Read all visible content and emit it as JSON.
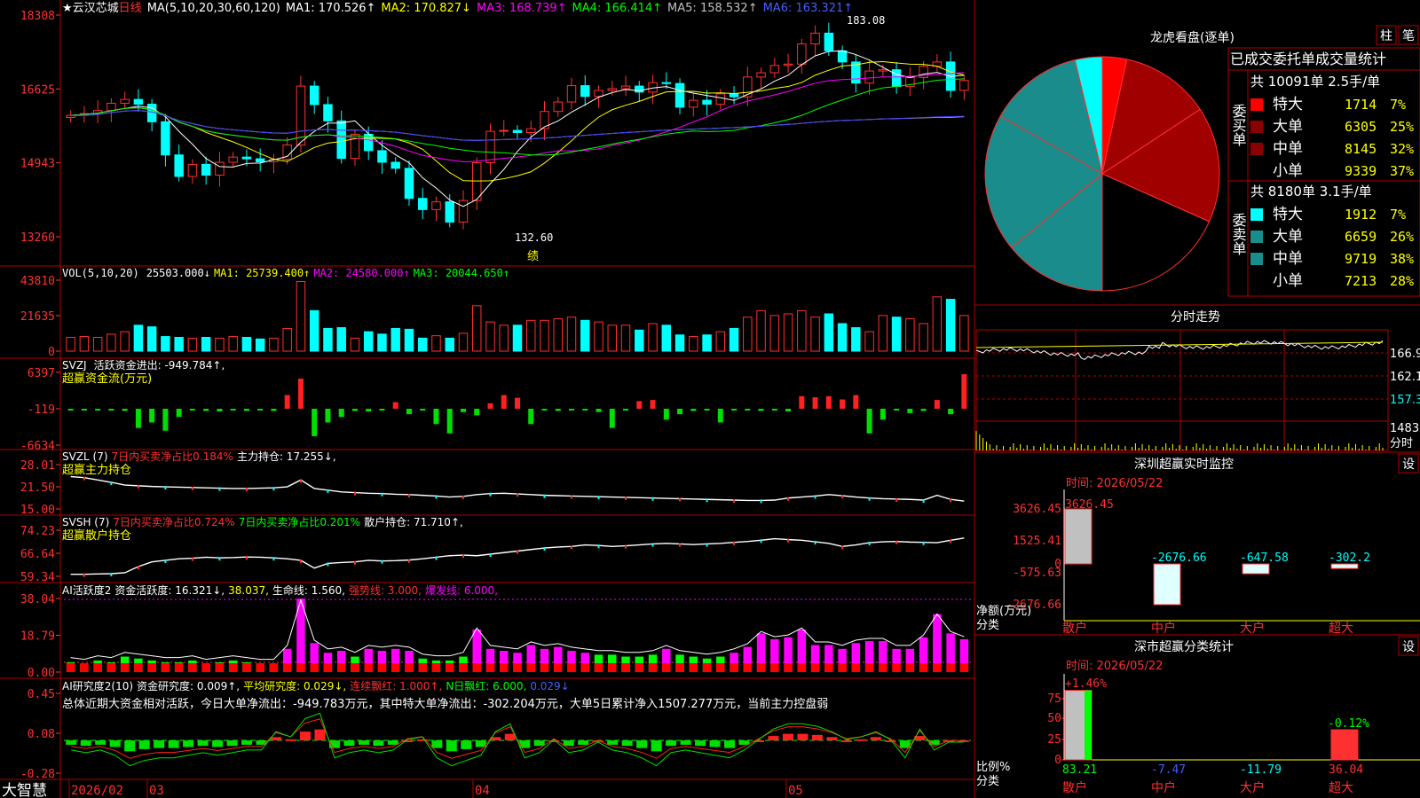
{
  "app": {
    "brand": "大智慧",
    "period_label": "日线",
    "star": "★"
  },
  "stock": {
    "name": "云汉芯城"
  },
  "colors": {
    "up": "#ff3030",
    "down": "#00ffff",
    "ma1": "#ffffff",
    "ma2": "#ffff00",
    "ma3": "#ff00ff",
    "ma4": "#00ff00",
    "ma5": "#c0c0c0",
    "ma6": "#4040ff",
    "frame": "#b00000",
    "grid": "#800000",
    "dark_red": "#8b0000",
    "teal": "#1a8c8c"
  },
  "main": {
    "ma_header": "MA(5,10,20,30,60,120)",
    "ma1": "MA1: 170.526↑",
    "ma2": "MA2: 170.827↓",
    "ma3": "MA3: 168.739↑",
    "ma4": "MA4: 166.414↑",
    "ma5": "MA5: 158.532↑",
    "ma6": "MA6: 163.321↑",
    "y_ticks": [
      "18308",
      "16625",
      "14943",
      "13260"
    ],
    "high_label": "183.08",
    "low_label": "132.60",
    "marker": "绩"
  },
  "vol": {
    "header": "VOL(5,10,20)",
    "val": "25503.000↓",
    "ma1": "MA1: 25739.400↑",
    "ma2": "MA2: 24580.000↑",
    "ma3": "MA3: 20044.650↑",
    "y_ticks": [
      "43810",
      "21635",
      "0"
    ]
  },
  "svzj": {
    "header": "SVZJ",
    "line1": "活跃资金进出: -949.784↑,",
    "line2": "超赢资金流(万元)",
    "y_ticks": [
      "6397",
      "-119",
      "-6634"
    ]
  },
  "svzl": {
    "header": "SVZL (7)",
    "red": "7日内买卖净占比0.184%",
    "white": "主力持仓: 17.255↓,",
    "line2": "超赢主力持仓",
    "y_ticks": [
      "28.01",
      "21.50",
      "15.00"
    ]
  },
  "svsh": {
    "header": "SVSH (7)",
    "red": "7日内买卖净占比0.724%",
    "green": "7日内买卖净占比0.201%",
    "white": "散户持仓: 71.710↑,",
    "line2": "超赢散户持仓",
    "y_ticks": [
      "74.23",
      "66.64",
      "59.34"
    ]
  },
  "ai1": {
    "header": "AI活跃度2",
    "w1": "资金活跃度: 16.321↓,",
    "y1": "38.037,",
    "w2": "生命线: 1.560,",
    "r1": "强势线: 3.000,",
    "m1": "爆发线: 6.000,",
    "y_ticks": [
      "38.04",
      "18.79",
      "0.00"
    ]
  },
  "ai2": {
    "header": "AI研究度2(10)",
    "w1": "资金研究度: 0.009↑,",
    "y1": "平均研究度: 0.029↓,",
    "r1": "连续飘红: 1.000↑,",
    "g1": "N日飘红: 6.000,",
    "b1": "0.029↓",
    "summary": "总体近期大资金相对活跃，今日大单净流出：-949.783万元，其中特大单净流出：-302.204万元，大单5日累计净入1507.277万元，当前主力控盘弱",
    "y_ticks": [
      "0.45",
      "0.08",
      "-0.28"
    ]
  },
  "xaxis": {
    "labels": [
      "2026/02",
      "03",
      "04",
      "05"
    ]
  },
  "pie": {
    "title": "龙虎看盘(逐单)",
    "btn1": "柱",
    "btn2": "笔",
    "heading": "已成交委托单成交量统计",
    "buy_label": "委买单",
    "buy_summary": "共 10091单 2.5手/单",
    "buy_rows": [
      {
        "name": "特大",
        "count": "1714",
        "pct": "7%"
      },
      {
        "name": "大单",
        "count": "6305",
        "pct": "25%"
      },
      {
        "name": "中单",
        "count": "8145",
        "pct": "32%"
      },
      {
        "name": "小单",
        "count": "9339",
        "pct": "37%"
      }
    ],
    "sell_label": "委卖单",
    "sell_summary": "共 8180单 3.1手/单",
    "sell_rows": [
      {
        "name": "特大",
        "count": "1912",
        "pct": "7%"
      },
      {
        "name": "大单",
        "count": "6659",
        "pct": "26%"
      },
      {
        "name": "中单",
        "count": "9719",
        "pct": "38%"
      },
      {
        "name": "小单",
        "count": "7213",
        "pct": "28%"
      }
    ]
  },
  "intraday": {
    "title": "分时走势",
    "y_ticks": [
      "166.9",
      "162.1",
      "157.3",
      "1483",
      "分时"
    ]
  },
  "monitor": {
    "title": "深圳超赢实时监控",
    "btn": "设",
    "time": "时间: 2026/05/22",
    "y_ticks": [
      "3626.45",
      "1525.41",
      "0",
      "-575.63",
      "-2676.66"
    ],
    "unit": "净额(万元)",
    "cat_label": "分类"
  },
  "classify": {
    "title": "深市超赢分类统计",
    "btn": "设",
    "time": "时间: 2026/05/22",
    "y_ticks": [
      "75",
      "50",
      "25",
      "0"
    ],
    "unit": "比例%",
    "cat_label": "分类"
  },
  "chart_data": [
    {
      "type": "candlestick",
      "title": "云汉芯城 日线",
      "ylim": [
        132.6,
        183.08
      ],
      "y_ticks": [
        132.6,
        149.43,
        166.25,
        183.08
      ],
      "x_labels": [
        "2026/02",
        "03",
        "04",
        "05"
      ],
      "series_ohlc_note": "close values approximated per bar",
      "close": [
        160.4,
        160.8,
        161.5,
        163.2,
        164.1,
        163.0,
        158.9,
        151.2,
        146.2,
        149.0,
        146.5,
        149.5,
        150.7,
        150.3,
        149.6,
        150.2,
        153.5,
        167.2,
        162.9,
        159.1,
        150.4,
        156.0,
        152.2,
        149.5,
        148.1,
        141.1,
        138.5,
        140.3,
        135.6,
        140.6,
        149.4,
        156.7,
        156.9,
        156.4,
        157.3,
        161.3,
        163.5,
        167.3,
        164.8,
        166.2,
        166.6,
        167.2,
        165.8,
        168.0,
        167.8,
        162.3,
        163.9,
        163.0,
        165.4,
        164.7,
        169.3,
        170.3,
        172.0,
        172.3,
        177.0,
        179.5,
        175.4,
        172.8,
        167.9,
        170.7,
        171.0,
        167.1,
        169.2,
        171.8,
        172.8,
        166.2,
        168.5
      ]
    },
    {
      "type": "bar",
      "title": "VOL(5,10,20)",
      "ylim": [
        0,
        43810
      ],
      "values": [
        8500,
        9000,
        8500,
        10500,
        12000,
        16000,
        15000,
        9000,
        8500,
        8000,
        8500,
        8000,
        9000,
        8500,
        7500,
        8000,
        14000,
        43000,
        25000,
        14000,
        14500,
        8000,
        12000,
        10500,
        14000,
        13500,
        8000,
        9500,
        8000,
        11000,
        28000,
        18000,
        16000,
        16000,
        19000,
        19000,
        20000,
        21000,
        19000,
        18000,
        16000,
        16000,
        13000,
        17000,
        16000,
        10000,
        9000,
        10000,
        12000,
        14000,
        21000,
        25000,
        22000,
        23000,
        25000,
        21000,
        23000,
        17000,
        14500,
        12000,
        22000,
        21000,
        20000,
        17000,
        33500,
        32000,
        22000
      ]
    },
    {
      "type": "bar",
      "title": "SVZJ 活跃资金进出",
      "ylim": [
        -6634,
        6397
      ],
      "values": [
        -200,
        -300,
        -200,
        -250,
        -400,
        -3500,
        -2500,
        -4000,
        -1500,
        -300,
        -400,
        -500,
        -300,
        -400,
        -300,
        -400,
        2500,
        5500,
        -5000,
        -2500,
        -1500,
        -400,
        -500,
        -300,
        1200,
        -1000,
        -200,
        -2800,
        -4500,
        -600,
        -1200,
        1000,
        2500,
        2000,
        -2800,
        -200,
        -400,
        -300,
        -200,
        -600,
        -3500,
        -300,
        1400,
        1600,
        -2000,
        -1000,
        -400,
        -300,
        -2500,
        -200,
        -300,
        -400,
        -300,
        -500,
        2300,
        2100,
        2300,
        1700,
        2500,
        -4500,
        -2000,
        -200,
        -800,
        -400,
        1600,
        -1000,
        6300,
        -3500,
        -1000
      ]
    },
    {
      "type": "line",
      "title": "SVZL 主力持仓",
      "ylim": [
        15.0,
        28.01
      ],
      "values": [
        24.5,
        24.2,
        23.5,
        22.8,
        22.0,
        21.8,
        21.6,
        21.5,
        21.4,
        21.3,
        21.2,
        21.1,
        21.0,
        21.0,
        21.1,
        21.2,
        21.5,
        23.5,
        21.0,
        20.5,
        20.0,
        19.8,
        19.6,
        19.5,
        19.3,
        19.2,
        19.0,
        18.8,
        18.5,
        18.7,
        19.2,
        19.5,
        19.6,
        19.4,
        19.2,
        19.0,
        18.9,
        18.8,
        18.7,
        18.6,
        18.5,
        18.4,
        18.3,
        18.2,
        18.1,
        18.0,
        17.9,
        17.8,
        17.7,
        17.6,
        17.5,
        17.5,
        17.6,
        18.2,
        18.5,
        18.8,
        19.2,
        18.9,
        18.5,
        18.2,
        18.0,
        17.9,
        17.8,
        17.6,
        19.0,
        17.8,
        17.3
      ]
    },
    {
      "type": "line",
      "title": "SVSH 散户持仓",
      "ylim": [
        59.34,
        74.23
      ],
      "values": [
        60.0,
        60.0,
        60.1,
        60.2,
        60.5,
        62.5,
        64.0,
        64.5,
        65.0,
        65.2,
        65.5,
        65.3,
        65.4,
        65.6,
        65.5,
        65.3,
        65.0,
        64.5,
        62.0,
        63.5,
        63.8,
        64.0,
        64.5,
        64.3,
        64.4,
        64.6,
        65.0,
        65.5,
        66.0,
        66.2,
        66.0,
        66.5,
        67.0,
        67.5,
        68.0,
        68.5,
        68.8,
        69.0,
        69.5,
        69.3,
        69.0,
        69.2,
        69.5,
        69.8,
        70.0,
        69.8,
        69.6,
        69.8,
        70.0,
        70.3,
        70.6,
        71.0,
        71.5,
        71.2,
        71.0,
        70.5,
        70.0,
        69.0,
        69.5,
        70.2,
        70.5,
        70.6,
        70.4,
        70.3,
        70.2,
        71.0,
        71.7
      ]
    },
    {
      "type": "bar",
      "title": "AI活跃度2 资金活跃度",
      "ylim": [
        0,
        38.04
      ],
      "values": [
        5,
        4,
        6,
        5,
        8,
        7,
        6,
        5,
        5,
        6,
        4,
        5,
        6,
        5,
        4,
        4,
        12,
        38,
        15,
        10,
        11,
        8,
        12,
        11,
        12,
        11,
        7,
        6,
        6,
        8,
        22,
        12,
        11,
        10,
        14,
        12,
        13,
        11,
        10,
        9,
        9,
        8,
        8,
        9,
        12,
        9,
        8,
        7,
        8,
        10,
        13,
        20,
        17,
        18,
        22,
        14,
        14,
        12,
        15,
        16,
        16,
        12,
        12,
        18,
        30,
        20,
        17
      ]
    },
    {
      "type": "bar",
      "title": "AI研究度2(10) 资金研究度",
      "ylim": [
        -0.28,
        0.45
      ],
      "values": [
        -0.02,
        -0.03,
        -0.02,
        -0.04,
        -0.08,
        -0.06,
        -0.05,
        -0.05,
        -0.04,
        -0.03,
        -0.04,
        -0.03,
        -0.02,
        -0.02,
        0.05,
        0.03,
        0.1,
        0.12,
        -0.05,
        -0.03,
        -0.02,
        -0.03,
        -0.02,
        0.02,
        0.03,
        -0.05,
        -0.08,
        -0.06,
        -0.04,
        0.05,
        0.08,
        -0.05,
        -0.03,
        0.02,
        -0.03,
        -0.02,
        0.01,
        -0.02,
        -0.03,
        -0.05,
        -0.08,
        -0.03,
        -0.02,
        -0.03,
        -0.04,
        -0.05,
        -0.02,
        0.02,
        0.06,
        0.08,
        0.08,
        0.07,
        0.05,
        0.02,
        0.03,
        0.05,
        0.02,
        -0.05,
        0.06,
        -0.02,
        0.01,
        0.01
      ]
    },
    {
      "type": "pie",
      "title": "龙虎看盘(逐单)",
      "slices": [
        {
          "name": "委买特大",
          "value": 1714,
          "color": "#ff0000"
        },
        {
          "name": "委买大单",
          "value": 6305,
          "color": "#a00000"
        },
        {
          "name": "委买中单",
          "value": 8145,
          "color": "#a00000"
        },
        {
          "name": "委买小单",
          "value": 9339,
          "color": "#000000"
        },
        {
          "name": "委卖小单",
          "value": 7213,
          "color": "#1a8c8c"
        },
        {
          "name": "委卖中单",
          "value": 9719,
          "color": "#1a8c8c"
        },
        {
          "name": "委卖大单",
          "value": 6659,
          "color": "#1a8c8c"
        },
        {
          "name": "委卖特大",
          "value": 1912,
          "color": "#00ffff"
        }
      ]
    },
    {
      "type": "bar",
      "title": "深圳超赢实时监控",
      "ylim": [
        -2676.66,
        3626.45
      ],
      "categories": [
        "散户",
        "中户",
        "大户",
        "超大"
      ],
      "values": [
        3626.45,
        -2676.66,
        -647.58,
        -302.2
      ],
      "value_labels": [
        "3626.45",
        "-2676.66",
        "-647.58",
        "-302.2"
      ]
    },
    {
      "type": "bar",
      "title": "深市超赢分类统计",
      "ylim": [
        0,
        83.21
      ],
      "categories": [
        "散户",
        "中户",
        "大户",
        "超大"
      ],
      "values": [
        83.21,
        -7.47,
        -11.79,
        36.04
      ],
      "value_labels": [
        "83.21",
        "-7.47",
        "-11.79",
        "36.04"
      ],
      "top_labels": [
        "+1.46%",
        "",
        "",
        "-0.12%"
      ]
    }
  ]
}
